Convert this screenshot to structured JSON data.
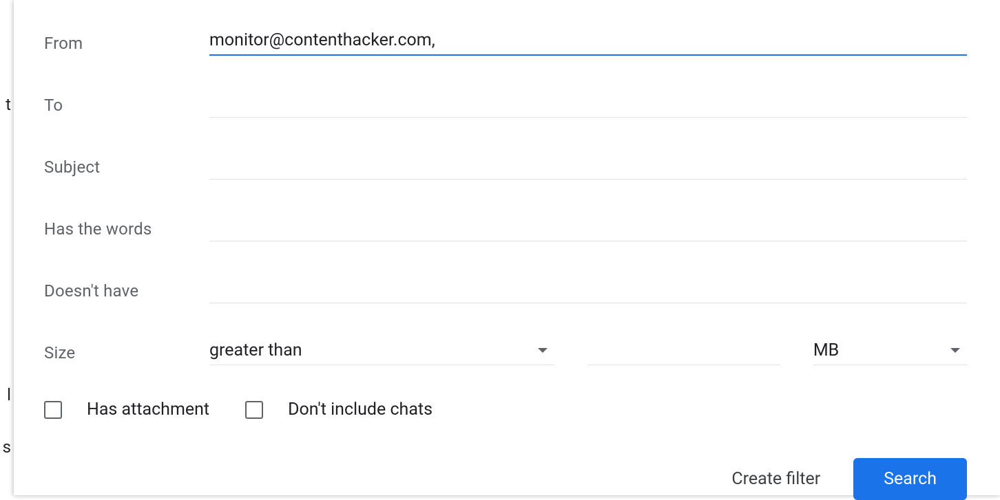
{
  "fields": {
    "from": {
      "label": "From",
      "value": "monitor@contenthacker.com,"
    },
    "to": {
      "label": "To",
      "value": ""
    },
    "subject": {
      "label": "Subject",
      "value": ""
    },
    "hasWords": {
      "label": "Has the words",
      "value": ""
    },
    "doesntHave": {
      "label": "Doesn't have",
      "value": ""
    }
  },
  "size": {
    "label": "Size",
    "comparator": "greater than",
    "value": "",
    "unit": "MB"
  },
  "checkboxes": {
    "hasAttachment": {
      "label": "Has attachment",
      "checked": false
    },
    "dontIncludeChats": {
      "label": "Don't include chats",
      "checked": false
    }
  },
  "actions": {
    "createFilter": "Create filter",
    "search": "Search"
  },
  "bgFragments": {
    "t": "t",
    "l": "l",
    "s": "s"
  }
}
